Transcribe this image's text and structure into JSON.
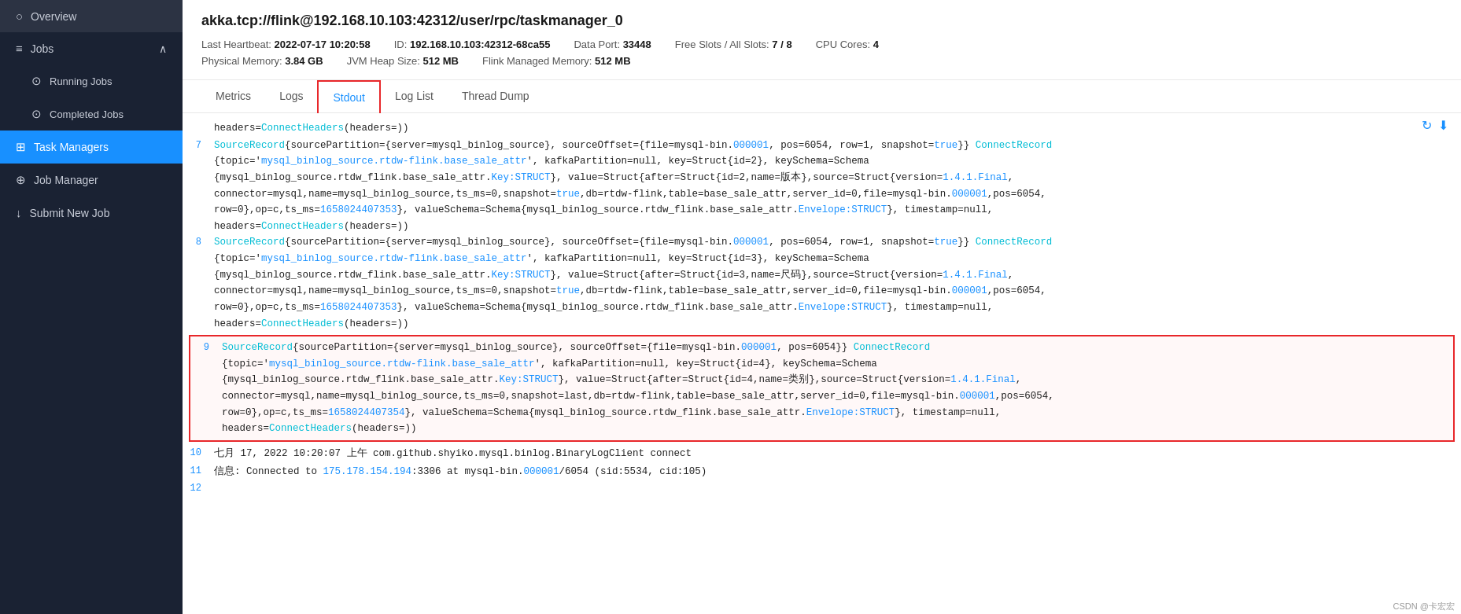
{
  "sidebar": {
    "items": [
      {
        "id": "overview",
        "label": "Overview",
        "icon": "○",
        "type": "item"
      },
      {
        "id": "jobs",
        "label": "Jobs",
        "icon": "≡",
        "type": "section",
        "expanded": true
      },
      {
        "id": "running-jobs",
        "label": "Running Jobs",
        "icon": "⊙",
        "type": "sub"
      },
      {
        "id": "completed-jobs",
        "label": "Completed Jobs",
        "icon": "⊙",
        "type": "sub"
      },
      {
        "id": "task-managers",
        "label": "Task Managers",
        "icon": "⊞",
        "type": "item",
        "active": true
      },
      {
        "id": "job-manager",
        "label": "Job Manager",
        "icon": "⊕",
        "type": "item"
      },
      {
        "id": "submit-new-job",
        "label": "Submit New Job",
        "icon": "↓",
        "type": "item"
      }
    ]
  },
  "header": {
    "title": "akka.tcp://flink@192.168.10.103:42312/user/rpc/taskmanager_0",
    "last_heartbeat_label": "Last Heartbeat:",
    "last_heartbeat_value": "2022-07-17 10:20:58",
    "id_label": "ID:",
    "id_value": "192.168.10.103:42312-68ca55",
    "data_port_label": "Data Port:",
    "data_port_value": "33448",
    "free_slots_label": "Free Slots / All Slots:",
    "free_slots_value": "7 / 8",
    "cpu_cores_label": "CPU Cores:",
    "cpu_cores_value": "4",
    "physical_memory_label": "Physical Memory:",
    "physical_memory_value": "3.84 GB",
    "jvm_heap_label": "JVM Heap Size:",
    "jvm_heap_value": "512 MB",
    "flink_memory_label": "Flink Managed Memory:",
    "flink_memory_value": "512 MB"
  },
  "tabs": [
    {
      "id": "metrics",
      "label": "Metrics",
      "active": false
    },
    {
      "id": "logs",
      "label": "Logs",
      "active": false
    },
    {
      "id": "stdout",
      "label": "Stdout",
      "active": true
    },
    {
      "id": "log-list",
      "label": "Log List",
      "active": false
    },
    {
      "id": "thread-dump",
      "label": "Thread Dump",
      "active": false
    }
  ],
  "log": {
    "lines": [
      {
        "num": "",
        "text": "headers=ConnectHeaders(headers=))",
        "type": "continuation"
      },
      {
        "num": "7",
        "text": "SourceRecord{sourcePartition={server=mysql_binlog_source}, sourceOffset={file=mysql-bin.000001, pos=6054, row=1, snapshot=true}} ConnectRecord{topic='mysql_binlog_source.rtdw-flink.base_sale_attr', kafkaPartition=null, key=Struct{id=2}, keySchema=Schema{mysql_binlog_source.rtdw_flink.base_sale_attr.Key:STRUCT}, value=Struct{after=Struct{id=2,name=版本},source=Struct{version=1.4.1.Final,connector=mysql,name=mysql_binlog_source,ts_ms=0,snapshot=true,db=rtdw-flink,table=base_sale_attr,server_id=0,file=mysql-bin.000001,pos=6054,row=0},op=c,ts_ms=1658024407353}, valueSchema=Schema{mysql_binlog_source.rtdw_flink.base_sale_attr.Envelope:STRUCT}, timestamp=null,\nheaders=ConnectHeaders(headers=))",
        "type": "multi"
      },
      {
        "num": "8",
        "text": "SourceRecord{sourcePartition={server=mysql_binlog_source}, sourceOffset={file=mysql-bin.000001, pos=6054, row=1, snapshot=true}} ConnectRecord{topic='mysql_binlog_source.rtdw-flink.base_sale_attr', kafkaPartition=null, key=Struct{id=3}, keySchema=Schema{mysql_binlog_source.rtdw_flink.base_sale_attr.Key:STRUCT}, value=Struct{after=Struct{id=3,name=尺码},source=Struct{version=1.4.1.Final,connector=mysql,name=mysql_binlog_source,ts_ms=0,snapshot=true,db=rtdw-flink,table=base_sale_attr,server_id=0,file=mysql-bin.000001,pos=6054,row=0},op=c,ts_ms=1658024407353}, valueSchema=Schema{mysql_binlog_source.rtdw_flink.base_sale_attr.Envelope:STRUCT}, timestamp=null,\nheaders=ConnectHeaders(headers=))",
        "type": "multi"
      },
      {
        "num": "9",
        "text": "SourceRecord{sourcePartition={server=mysql_binlog_source}, sourceOffset={file=mysql-bin.000001, pos=6054}} ConnectRecord{topic='mysql_binlog_source.rtdw-flink.base_sale_attr', kafkaPartition=null, key=Struct{id=4}, keySchema=Schema{mysql_binlog_source.rtdw_flink.base_sale_attr.Key:STRUCT}, value=Struct{after=Struct{id=4,name=类别},source=Struct{version=1.4.1.Final,connector=mysql,name=mysql_binlog_source,ts_ms=0,snapshot=last,db=rtdw-flink,table=base_sale_attr,server_id=0,file=mysql-bin.000001,pos=6054,row=0},op=c,ts_ms=1658024407354}, valueSchema=Schema{mysql_binlog_source.rtdw_flink.base_sale_attr.Envelope:STRUCT}, timestamp=null,\nheaders=ConnectHeaders(headers=))",
        "type": "multi",
        "highlighted": true
      },
      {
        "num": "10",
        "text": "七月 17, 2022 10:20:07 上午 com.github.shyiko.mysql.binlog.BinaryLogClient connect",
        "type": "single"
      },
      {
        "num": "11",
        "text": "信息: Connected to 175.178.154.194:3306 at mysql-bin.000001/6054 (sid:5534, cid:105)",
        "type": "single"
      },
      {
        "num": "12",
        "text": "",
        "type": "single"
      }
    ],
    "watermark": "CSDN @卡宏宏"
  }
}
